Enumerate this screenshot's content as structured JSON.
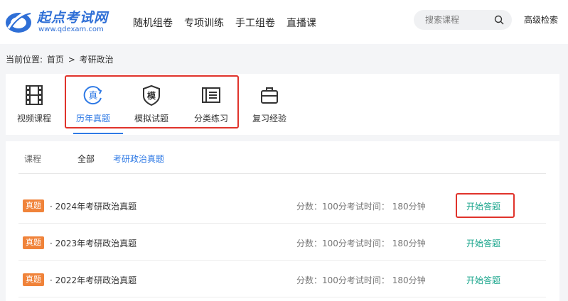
{
  "header": {
    "logo_name": "起点考试网",
    "logo_url": "www.qdexam.com",
    "nav": [
      "随机组卷",
      "专项训练",
      "手工组卷",
      "直播课"
    ],
    "search_placeholder": "搜索课程",
    "advanced_search": "高级检索"
  },
  "breadcrumb": {
    "prefix": "当前位置:",
    "home": "首页",
    "sep": ">",
    "current": "考研政治"
  },
  "categories": [
    {
      "label": "视频课程",
      "icon": "film-icon",
      "active": false
    },
    {
      "label": "历年真题",
      "icon": "real-exam-icon",
      "active": true
    },
    {
      "label": "模拟试题",
      "icon": "mock-exam-icon",
      "active": false
    },
    {
      "label": "分类练习",
      "icon": "practice-icon",
      "active": false
    },
    {
      "label": "复习经验",
      "icon": "briefcase-icon",
      "active": false
    }
  ],
  "filter": {
    "label": "课程",
    "all": "全部",
    "current": "考研政治真题"
  },
  "exams": [
    {
      "badge": "真题",
      "title": "· 2024年考研政治真题",
      "meta": "分数：100分考试时间：  180分钟",
      "action": "开始答题"
    },
    {
      "badge": "真题",
      "title": "· 2023年考研政治真题",
      "meta": "分数：100分考试时间：  180分钟",
      "action": "开始答题"
    },
    {
      "badge": "真题",
      "title": "· 2022年考研政治真题",
      "meta": "分数：100分考试时间：  180分钟",
      "action": "开始答题"
    }
  ],
  "colors": {
    "accent": "#2f7ae5",
    "badge": "#f0833a",
    "action": "#1aa58c",
    "highlight": "#e0332b"
  }
}
